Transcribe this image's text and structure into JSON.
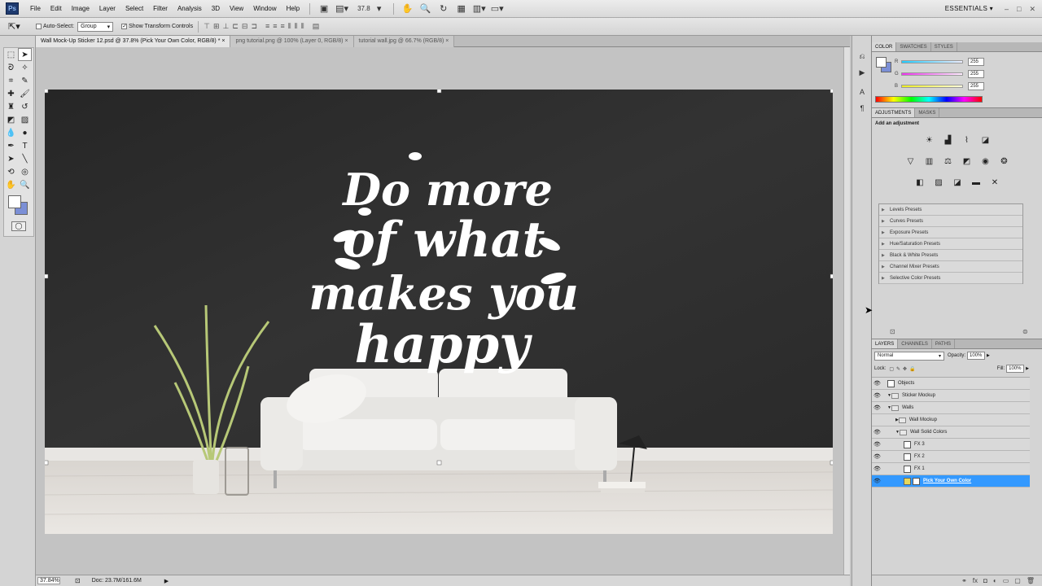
{
  "app": {
    "logo": "Ps"
  },
  "menu": [
    "File",
    "Edit",
    "Image",
    "Layer",
    "Select",
    "Filter",
    "Analysis",
    "3D",
    "View",
    "Window",
    "Help"
  ],
  "menubar": {
    "zoom": "37.8",
    "workspace": "ESSENTIALS"
  },
  "options": {
    "auto_select_label": "Auto-Select:",
    "auto_select_value": "Group",
    "transform_label": "Show Transform Controls",
    "transform_checked": true
  },
  "tabs": [
    {
      "label": "Wall Mock-Up Sticker 12.psd @ 37.8% (Pick Your Own Color, RGB/8) *",
      "active": true
    },
    {
      "label": "png tutorial.png @ 100% (Layer 0, RGB/8)",
      "active": false
    },
    {
      "label": "tutorial wall.jpg @ 66.7% (RGB/8)",
      "active": false
    }
  ],
  "canvas": {
    "lettering": [
      "Do more",
      "of what",
      "makes you",
      "happy"
    ]
  },
  "status": {
    "zoom": "37.84%",
    "doc": "Doc: 23.7M/161.6M"
  },
  "color_panel": {
    "tabs": [
      "COLOR",
      "SWATCHES",
      "STYLES"
    ],
    "r_label": "R",
    "g_label": "G",
    "b_label": "B",
    "r": "255",
    "g": "255",
    "b": "255",
    "fg_color": "#ffffff",
    "bg_color": "#7b8fd6"
  },
  "adjustments": {
    "tabs": [
      "ADJUSTMENTS",
      "MASKS"
    ],
    "title": "Add an adjustment",
    "presets": [
      "Levels Presets",
      "Curves Presets",
      "Exposure Presets",
      "Hue/Saturation Presets",
      "Black & White Presets",
      "Channel Mixer Presets",
      "Selective Color Presets"
    ]
  },
  "layers_panel": {
    "tabs": [
      "LAYERS",
      "CHANNELS",
      "PATHS"
    ],
    "blend_mode": "Normal",
    "opacity_label": "Opacity:",
    "opacity": "100%",
    "lock_label": "Lock:",
    "fill_label": "Fill:",
    "fill": "100%",
    "layers": [
      {
        "name": "Objects",
        "type": "smart",
        "indent": 0,
        "visible": true
      },
      {
        "name": "Sticker Mockup",
        "type": "group",
        "indent": 0,
        "visible": true
      },
      {
        "name": "Walls",
        "type": "group",
        "indent": 0,
        "visible": true
      },
      {
        "name": "Wall Mockup",
        "type": "group",
        "indent": 1,
        "visible": false
      },
      {
        "name": "Wall Solid Colors",
        "type": "group",
        "indent": 1,
        "visible": true
      },
      {
        "name": "FX 3",
        "type": "fx",
        "indent": 2,
        "visible": true
      },
      {
        "name": "FX 2",
        "type": "fx",
        "indent": 2,
        "visible": true
      },
      {
        "name": "FX 1",
        "type": "fx",
        "indent": 2,
        "visible": true
      },
      {
        "name": "Pick Your Own Color",
        "type": "fill",
        "indent": 2,
        "visible": true,
        "active": true
      }
    ]
  }
}
